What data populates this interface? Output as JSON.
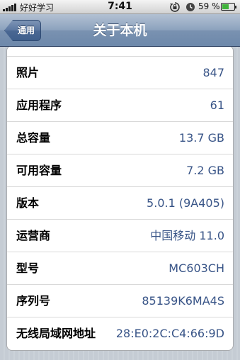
{
  "status_bar": {
    "carrier": "好好学习",
    "time": "7:41",
    "battery_percent": "59 %",
    "battery_level": 0.59
  },
  "nav": {
    "back_label": "通用",
    "title": "关于本机"
  },
  "rows": [
    {
      "label": "照片",
      "value": "847"
    },
    {
      "label": "应用程序",
      "value": "61"
    },
    {
      "label": "总容量",
      "value": "13.7 GB"
    },
    {
      "label": "可用容量",
      "value": "7.2 GB"
    },
    {
      "label": "版本",
      "value": "5.0.1 (9A405)"
    },
    {
      "label": "运营商",
      "value": "中国移动 11.0"
    },
    {
      "label": "型号",
      "value": "MC603CH"
    },
    {
      "label": "序列号",
      "value": "85139K6MA4S"
    },
    {
      "label": "无线局域网地址",
      "value": "28:E0:2C:C4:66:9D"
    }
  ]
}
